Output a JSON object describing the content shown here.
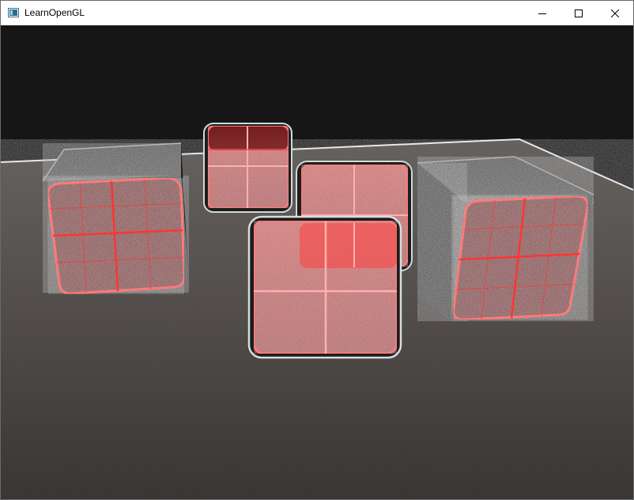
{
  "window": {
    "title": "LearnOpenGL",
    "controls": {
      "minimize": "minimize",
      "maximize": "maximize",
      "close": "close"
    }
  },
  "scene": {
    "background_color": "#161616",
    "floor_color": "#5a5552",
    "crate_frame_color": "#ff3030",
    "crate_face_color": "#8a1e22",
    "glass_color": "#ff5a5a",
    "marble_color": "#3a3a3a"
  }
}
